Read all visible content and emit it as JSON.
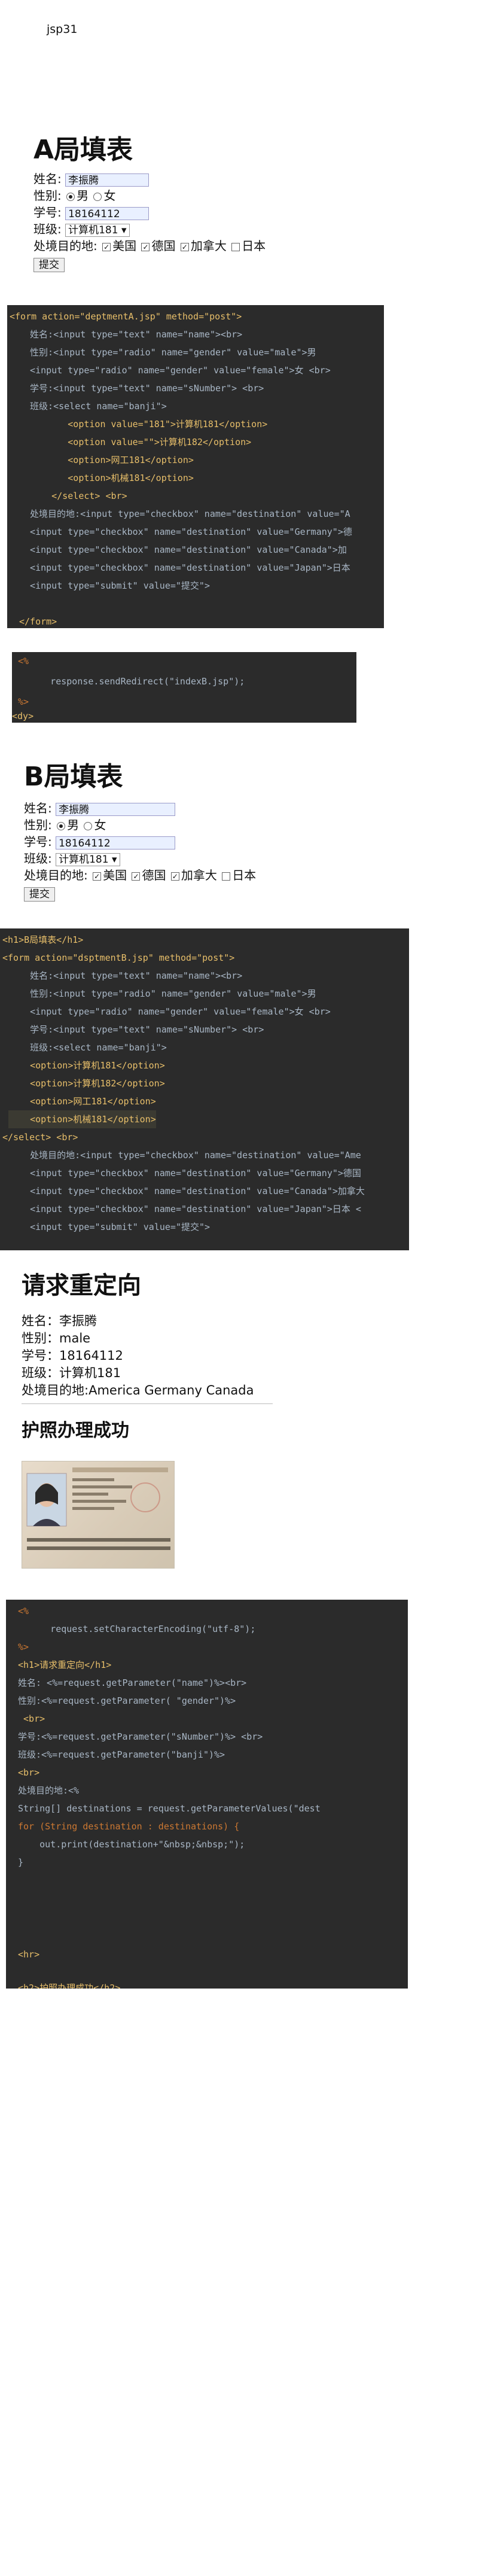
{
  "doc_title": "jsp31",
  "formA": {
    "heading": "A局填表",
    "name_label": "姓名:",
    "name_value": "李振腾",
    "gender_label": "性别:",
    "male": "男",
    "female": "女",
    "number_label": "学号:",
    "number_value": "18164112",
    "class_label": "班级:",
    "class_value": "计算机181",
    "dest_label": "处境目的地:",
    "dest_options": [
      "美国",
      "德国",
      "加拿大",
      "日本"
    ],
    "submit": "提交"
  },
  "codeA": [
    "<form action=\"deptmentA.jsp\" method=\"post\">",
    "  姓名:<input type=\"text\" name=\"name\"><br>",
    "  性别:<input type=\"radio\" name=\"gender\" value=\"male\">男",
    "  <input type=\"radio\" name=\"gender\" value=\"female\">女 <br>",
    "  学号:<input type=\"text\" name=\"sNumber\"> <br>",
    "  班级:<select name=\"banji\">",
    "         <option value=\"181\">计算机181</option>",
    "         <option value=\"\">计算机182</option>",
    "         <option>网工181</option>",
    "         <option>机械181</option>",
    "      </select> <br>",
    "  处境目的地:<input type=\"checkbox\" name=\"destination\" value=\"A",
    "  <input type=\"checkbox\" name=\"destination\" value=\"Germany\">德",
    "  <input type=\"checkbox\" name=\"destination\" value=\"Canada\">加",
    "  <input type=\"checkbox\" name=\"destination\" value=\"Japan\">日本",
    "  <input type=\"submit\" value=\"提交\">",
    "",
    "</form>"
  ],
  "codeRedirect": [
    "<%",
    "      response.sendRedirect(\"indexB.jsp\");",
    "%>",
    "<dy>"
  ],
  "formB": {
    "heading": "B局填表",
    "name_label": "姓名:",
    "name_value": "李振腾",
    "gender_label": "性别:",
    "male": "男",
    "female": "女",
    "number_label": "学号:",
    "number_value": "18164112",
    "class_label": "班级:",
    "class_value": "计算机181",
    "dest_label": "处境目的地:",
    "dest_options": [
      "美国",
      "德国",
      "加拿大",
      "日本"
    ],
    "submit": "提交"
  },
  "codeB": [
    "<h1>B局填表</h1>",
    "<form action=\"dsptmentB.jsp\" method=\"post\">",
    "    姓名:<input type=\"text\" name=\"name\"><br>",
    "    性别:<input type=\"radio\" name=\"gender\" value=\"male\">男",
    "    <input type=\"radio\" name=\"gender\" value=\"female\">女 <br>",
    "    学号:<input type=\"text\" name=\"sNumber\"> <br>",
    "    班级:<select name=\"banji\">",
    "    <option>计算机181</option>",
    "    <option>计算机182</option>",
    "    <option>网工181</option>",
    "    <option>机械181</option>",
    "</select> <br>",
    "    处境目的地:<input type=\"checkbox\" name=\"destination\" value=\"Ame",
    "    <input type=\"checkbox\" name=\"destination\" value=\"Germany\">德国",
    "    <input type=\"checkbox\" name=\"destination\" value=\"Canada\">加拿大",
    "    <input type=\"checkbox\" name=\"destination\" value=\"Japan\">日本 <",
    "    <input type=\"submit\" value=\"提交\">"
  ],
  "result": {
    "heading": "请求重定向",
    "rows": [
      "姓名：李振腾",
      "性别：male",
      "学号：18164112",
      "班级：计算机181",
      "处境目的地:America  Germany  Canada"
    ],
    "success": "护照办理成功"
  },
  "codeC": [
    "<%",
    "      request.setCharacterEncoding(\"utf-8\");",
    "%>",
    "<h1>请求重定向</h1>",
    "姓名: <%=request.getParameter(\"name\")%><br>",
    "性别:<%=request.getParameter( \"gender\")%>",
    " <br>",
    "学号:<%=request.getParameter(\"sNumber\")%> <br>",
    "班级:<%=request.getParameter(\"banji\")%>",
    "<br>",
    "处境目的地:<%",
    "String[] destinations = request.getParameterValues(\"dest",
    "for (String destination : destinations) {",
    "    out.print(destination+\"&nbsp;&nbsp;\");",
    "}",
    "",
    "",
    "",
    "",
    "<hr>",
    "",
    "<h2>护照办理成功</h2>"
  ],
  "colors": {
    "code_bg": "#2b2b2b",
    "tag": "#e8bf6a",
    "string": "#6a8759",
    "keyword": "#cc7832"
  }
}
